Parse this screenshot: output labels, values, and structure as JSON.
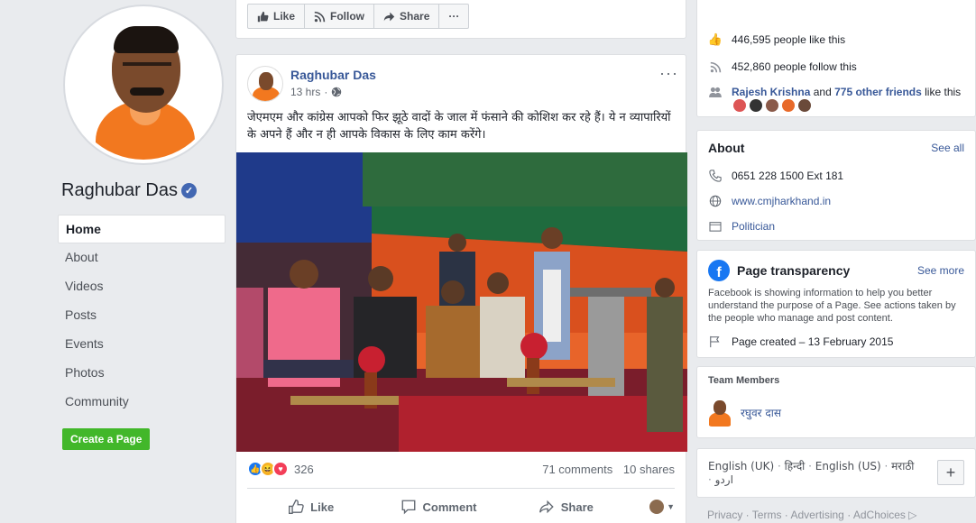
{
  "page": {
    "name": "Raghubar Das",
    "verified": true
  },
  "nav": {
    "items": [
      {
        "label": "Home",
        "active": true
      },
      {
        "label": "About"
      },
      {
        "label": "Videos"
      },
      {
        "label": "Posts"
      },
      {
        "label": "Events"
      },
      {
        "label": "Photos"
      },
      {
        "label": "Community"
      }
    ],
    "create_page": "Create a Page"
  },
  "page_actions": {
    "like": "Like",
    "follow": "Follow",
    "share": "Share",
    "more": "···"
  },
  "post": {
    "author": "Raghubar Das",
    "time": "13 hrs",
    "more": "···",
    "text": "जेएमएम और कांग्रेस आपको फिर झूठे वादों के जाल में फंसाने की कोशिश कर रहे हैं। ये न व्यापारियों के अपने हैं और न ही आपके विकास के लिए काम करेंगे।",
    "reaction_count": "326",
    "comments": "71 comments",
    "shares": "10 shares",
    "actions": {
      "like": "Like",
      "comment": "Comment",
      "share": "Share"
    }
  },
  "community": {
    "likes_partial": "446,595 people like this",
    "follows": "452,860 people follow this",
    "friend_name": "Rajesh Krishna",
    "and": "and",
    "other_friends": "775 other friends",
    "like_this": "like this"
  },
  "about": {
    "title": "About",
    "see_all": "See all",
    "phone": "0651 228 1500 Ext 181",
    "website": "www.cmjharkhand.in",
    "category": "Politician"
  },
  "transparency": {
    "title": "Page transparency",
    "see_more": "See more",
    "description": "Facebook is showing information to help you better understand the purpose of a Page. See actions taken by the people who manage and post content.",
    "created": "Page created – 13 February 2015"
  },
  "team": {
    "title": "Team Members",
    "member": "रघुवर दास"
  },
  "languages": {
    "items": [
      "English (UK)",
      "हिन्दी",
      "English (US)",
      "मराठी",
      "اردو"
    ],
    "add": "+"
  },
  "footer": {
    "links": [
      "Privacy",
      "Terms",
      "Advertising",
      "AdChoices"
    ]
  },
  "colors": {
    "fb_blue": "#385898",
    "brand_blue": "#4267b2",
    "green": "#42b72a",
    "background": "#e9ebee"
  }
}
